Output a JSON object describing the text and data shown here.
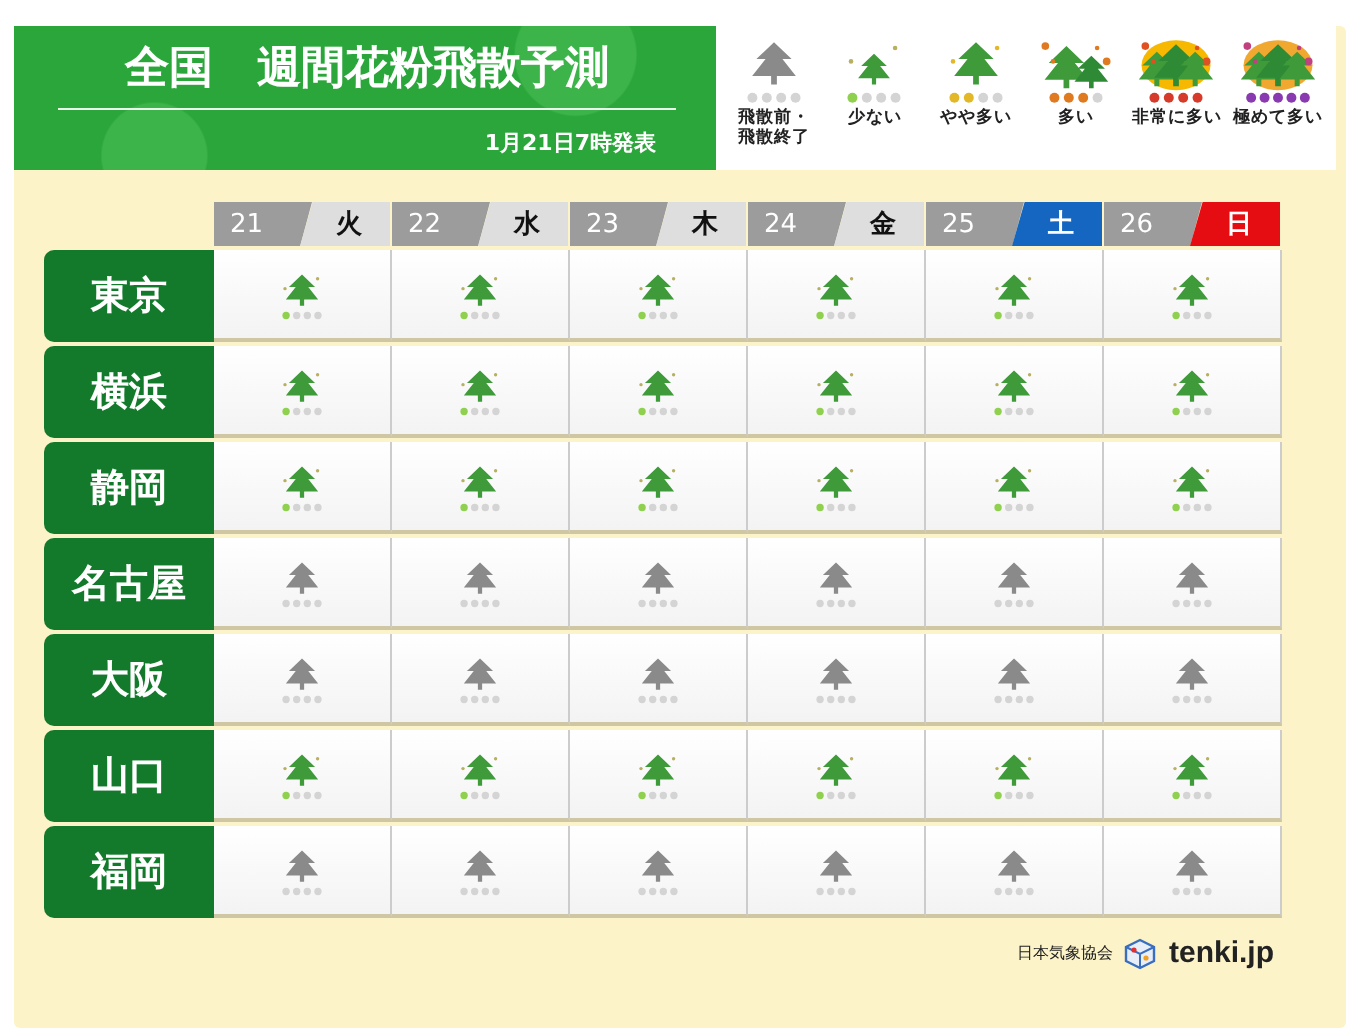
{
  "header": {
    "title": "全国　週間花粉飛散予測",
    "issued": "1月21日7時発表"
  },
  "legend": [
    {
      "kind": "none",
      "label": "飛散前・飛散終了"
    },
    {
      "kind": "low",
      "label": "少ない"
    },
    {
      "kind": "moderate",
      "label": "やや多い"
    },
    {
      "kind": "high",
      "label": "多い"
    },
    {
      "kind": "very_high",
      "label": "非常に多い"
    },
    {
      "kind": "extreme",
      "label": "極めて多い"
    }
  ],
  "days": [
    {
      "date": "21",
      "weekday": "火",
      "kind": "weekday"
    },
    {
      "date": "22",
      "weekday": "水",
      "kind": "weekday"
    },
    {
      "date": "23",
      "weekday": "木",
      "kind": "weekday"
    },
    {
      "date": "24",
      "weekday": "金",
      "kind": "weekday"
    },
    {
      "date": "25",
      "weekday": "土",
      "kind": "saturday"
    },
    {
      "date": "26",
      "weekday": "日",
      "kind": "sunday"
    }
  ],
  "cities": [
    {
      "name": "東京",
      "cells": [
        {
          "kind": "low"
        },
        {
          "kind": "low"
        },
        {
          "kind": "low"
        },
        {
          "kind": "low"
        },
        {
          "kind": "low"
        },
        {
          "kind": "low"
        }
      ]
    },
    {
      "name": "横浜",
      "cells": [
        {
          "kind": "low"
        },
        {
          "kind": "low"
        },
        {
          "kind": "low"
        },
        {
          "kind": "low"
        },
        {
          "kind": "low"
        },
        {
          "kind": "low"
        }
      ]
    },
    {
      "name": "静岡",
      "cells": [
        {
          "kind": "low"
        },
        {
          "kind": "low"
        },
        {
          "kind": "low"
        },
        {
          "kind": "low"
        },
        {
          "kind": "low"
        },
        {
          "kind": "low"
        }
      ]
    },
    {
      "name": "名古屋",
      "cells": [
        {
          "kind": "none"
        },
        {
          "kind": "none"
        },
        {
          "kind": "none"
        },
        {
          "kind": "none"
        },
        {
          "kind": "none"
        },
        {
          "kind": "none"
        }
      ]
    },
    {
      "name": "大阪",
      "cells": [
        {
          "kind": "none"
        },
        {
          "kind": "none"
        },
        {
          "kind": "none"
        },
        {
          "kind": "none"
        },
        {
          "kind": "none"
        },
        {
          "kind": "none"
        }
      ]
    },
    {
      "name": "山口",
      "cells": [
        {
          "kind": "low"
        },
        {
          "kind": "low"
        },
        {
          "kind": "low"
        },
        {
          "kind": "low"
        },
        {
          "kind": "low"
        },
        {
          "kind": "low"
        }
      ]
    },
    {
      "name": "福岡",
      "cells": [
        {
          "kind": "none"
        },
        {
          "kind": "none"
        },
        {
          "kind": "none"
        },
        {
          "kind": "none"
        },
        {
          "kind": "none"
        },
        {
          "kind": "none"
        }
      ]
    }
  ],
  "footer": {
    "agency": "日本気象協会",
    "brand": "tenki.jp"
  }
}
